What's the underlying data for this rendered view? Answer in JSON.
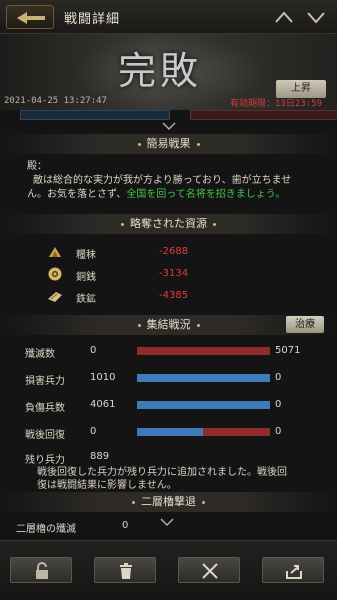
{
  "header": {
    "title": "戦闘詳細"
  },
  "banner": {
    "result": "完敗",
    "rise_label": "上昇",
    "date": "2021-04-25 13:27:47",
    "expiry": "有効期限：13日23:59"
  },
  "summary": {
    "heading": "簡易戦果",
    "line1": "殿：",
    "line2": "敵は総合的な実力が我が方より勝っており、歯が立ちませ",
    "line3_prefix": "ん。お気を落とさず、",
    "line3_green": "全国を回って名将を招きましょう。"
  },
  "resources": {
    "heading": "略奪された資源",
    "items": [
      {
        "label": "糧秣",
        "value": "-2688",
        "icon": "grain-icon"
      },
      {
        "label": "銅銭",
        "value": "-3134",
        "icon": "coin-icon"
      },
      {
        "label": "鉄鉱",
        "value": "-4385",
        "icon": "iron-ore-icon"
      }
    ]
  },
  "battle": {
    "heading": "集結戦況",
    "cure_label": "治療",
    "rows": [
      {
        "label": "殲滅数",
        "left": "0",
        "right": "5071",
        "left_fraction": 0,
        "right_fraction": 1
      },
      {
        "label": "損害兵力",
        "left": "1010",
        "right": "0",
        "left_fraction": 1,
        "right_fraction": 0
      },
      {
        "label": "負傷兵数",
        "left": "4061",
        "right": "0",
        "left_fraction": 1,
        "right_fraction": 0
      },
      {
        "label": "戦後回復",
        "left": "0",
        "right": "0",
        "left_fraction": 0.5,
        "right_fraction": 0.5
      }
    ],
    "remaining_label": "残り兵力",
    "remaining_value": "889",
    "note_line1": "戦後回復した兵力が残り兵力に追加されました。戦後回",
    "note_line2": "復は戦闘結果に影響しません。"
  },
  "tower": {
    "heading": "二層櫓撃退",
    "row_label": "二層櫓の殲滅",
    "row_value": "0"
  },
  "colors": {
    "blue": "#3f7bb8",
    "red": "#8e2c2c",
    "loss_text": "#e63a3a",
    "green_text": "#48c24a"
  },
  "toolbar": {
    "buttons": [
      "lock-icon",
      "trash-icon",
      "crossed-swords-icon",
      "share-icon"
    ]
  }
}
